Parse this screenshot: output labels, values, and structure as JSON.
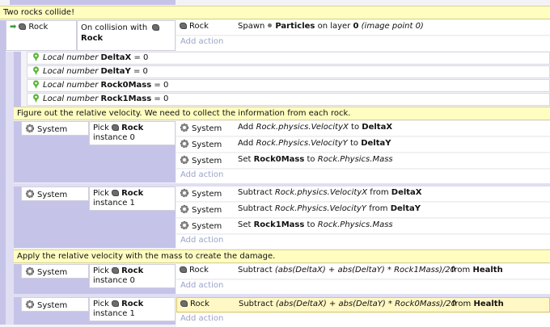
{
  "comments": {
    "c1": "Two rocks collide!",
    "c2": "Figure out the relative velocity.  We need to collect the information from each rock.",
    "c3": "Apply the relative velocity with the mass to create the damage."
  },
  "event1": {
    "object": "Rock",
    "condition_prefix": "On collision with",
    "condition_target": "Rock",
    "action_object": "Rock",
    "action_text_1": "Spawn",
    "action_bold": "Particles",
    "action_text_2": "on layer",
    "action_layer": "0",
    "action_tail": "(image point 0)",
    "add_action": "Add action"
  },
  "local_vars": [
    {
      "prefix": "Local number",
      "name": "DeltaX",
      "value": "= 0"
    },
    {
      "prefix": "Local number",
      "name": "DeltaY",
      "value": "= 0"
    },
    {
      "prefix": "Local number",
      "name": "Rock0Mass",
      "value": "= 0"
    },
    {
      "prefix": "Local number",
      "name": "Rock1Mass",
      "value": "= 0"
    }
  ],
  "sub1": {
    "system": "System",
    "pick": "Pick",
    "pick_obj": "Rock",
    "instance": "instance 0",
    "actions": [
      {
        "obj": "System",
        "pre": "Add",
        "expr": "Rock.physics.VelocityX",
        "mid": "to",
        "var": "DeltaX"
      },
      {
        "obj": "System",
        "pre": "Add",
        "expr": "Rock.Physics.VelocityY",
        "mid": "to",
        "var": "DeltaY"
      },
      {
        "obj": "System",
        "pre": "Set",
        "var": "Rock0Mass",
        "mid": "to",
        "expr": "Rock.Physics.Mass"
      }
    ],
    "add_action": "Add action"
  },
  "sub2": {
    "system": "System",
    "pick": "Pick",
    "pick_obj": "Rock",
    "instance": "instance 1",
    "actions": [
      {
        "obj": "System",
        "pre": "Subtract",
        "expr": "Rock.physics.VelocityX",
        "mid": "from",
        "var": "DeltaX"
      },
      {
        "obj": "System",
        "pre": "Subtract",
        "expr": "Rock.Physics.VelocityY",
        "mid": "from",
        "var": "DeltaY"
      },
      {
        "obj": "System",
        "pre": "Set",
        "var": "Rock1Mass",
        "mid": "to",
        "expr": "Rock.Physics.Mass"
      }
    ],
    "add_action": "Add action"
  },
  "sub3": {
    "system": "System",
    "pick": "Pick",
    "pick_obj": "Rock",
    "instance": "instance 0",
    "action_obj": "Rock",
    "action_pre": "Subtract",
    "action_expr": "(abs(DeltaX) + abs(DeltaY) * Rock1Mass)/20",
    "action_mid": "from",
    "action_var": "Health",
    "add_action": "Add action"
  },
  "sub4": {
    "system": "System",
    "pick": "Pick",
    "pick_obj": "Rock",
    "instance": "instance 1",
    "action_obj": "Rock",
    "action_pre": "Subtract",
    "action_expr": "(abs(DeltaX) + abs(DeltaY) * Rock0Mass)/20",
    "action_mid": "from",
    "action_var": "Health",
    "add_action": "Add action"
  },
  "colors": {
    "comment_bg": "#fffdc0",
    "event_bar": "#c6c3e8",
    "add_action_text": "#9aa3c8",
    "selected_bg": "#fff7c4"
  }
}
